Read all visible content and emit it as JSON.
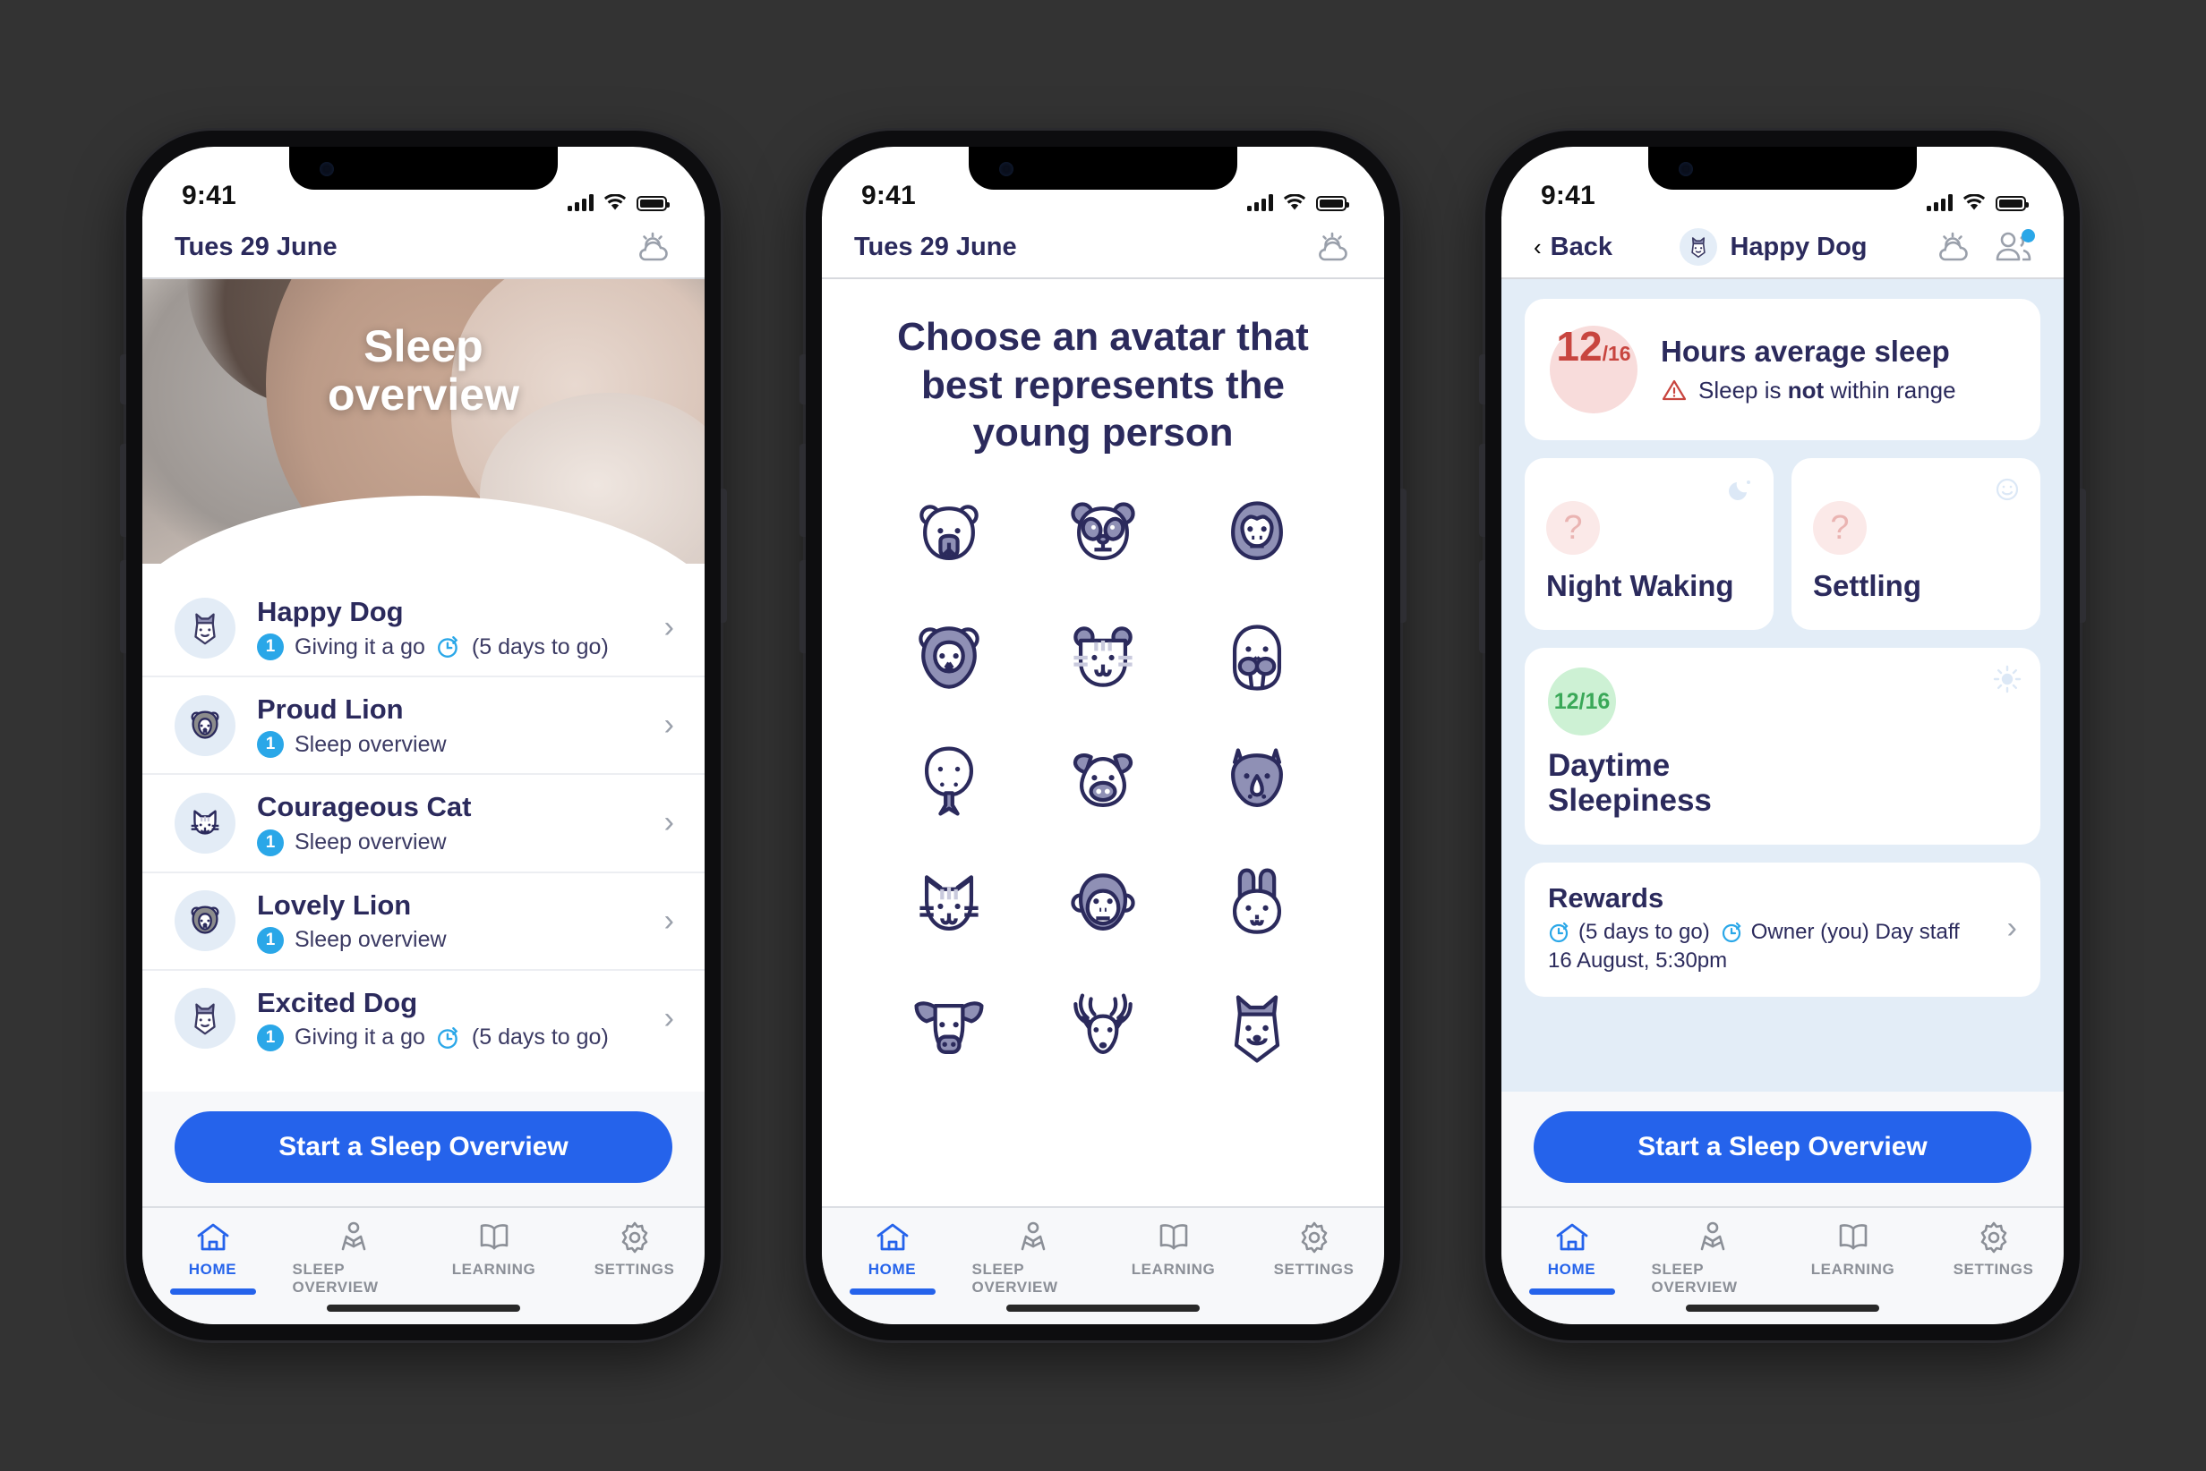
{
  "status_bar": {
    "time": "9:41",
    "signal_icon": "cellular-bars-icon",
    "wifi_icon": "wifi-icon",
    "battery_icon": "battery-icon"
  },
  "tabs": [
    {
      "label": "HOME",
      "icon": "home-icon",
      "active": true
    },
    {
      "label": "SLEEP OVERVIEW",
      "icon": "person-reading-icon",
      "active": false
    },
    {
      "label": "LEARNING",
      "icon": "book-icon",
      "active": false
    },
    {
      "label": "SETTINGS",
      "icon": "gear-icon",
      "active": false
    }
  ],
  "cta": {
    "label": "Start a Sleep Overview"
  },
  "colors": {
    "primary_blue": "#2563eb",
    "badge_blue": "#2aa7e8",
    "navy": "#2b2a5c",
    "alert_red": "#c8453f",
    "ok_green": "#3aa858",
    "tint_bg": "#e3edf7"
  },
  "screen1": {
    "appbar": {
      "date": "Tues 29 June",
      "weather_icon": "partly-cloudy-icon"
    },
    "hero": {
      "title_line1": "Sleep",
      "title_line2": "overview"
    },
    "children": [
      {
        "name": "Happy Dog",
        "avatar": "dog-icon",
        "badge": "1",
        "status": "Giving it a go",
        "timer_icon": "timer-icon",
        "timer_text": "(5 days to go)"
      },
      {
        "name": "Proud Lion",
        "avatar": "lion-icon",
        "badge": "1",
        "status": "Sleep overview",
        "timer_icon": "",
        "timer_text": ""
      },
      {
        "name": "Courageous Cat",
        "avatar": "cat-icon",
        "badge": "1",
        "status": "Sleep overview",
        "timer_icon": "",
        "timer_text": ""
      },
      {
        "name": "Lovely Lion",
        "avatar": "lion-icon",
        "badge": "1",
        "status": "Sleep overview",
        "timer_icon": "",
        "timer_text": ""
      },
      {
        "name": "Excited Dog",
        "avatar": "dog-icon",
        "badge": "1",
        "status": "Giving it a go",
        "timer_icon": "timer-icon",
        "timer_text": "(5 days to go)"
      }
    ]
  },
  "screen2": {
    "appbar": {
      "date": "Tues 29 June",
      "weather_icon": "partly-cloudy-icon"
    },
    "heading": "Choose an avatar that best represents the young person",
    "avatars": [
      "bear-icon",
      "panda-icon",
      "gorilla-icon",
      "lion-icon",
      "tiger-icon",
      "walrus-icon",
      "whale-icon",
      "pig-icon",
      "rhino-icon",
      "cat-icon",
      "monkey-icon",
      "rabbit-icon",
      "cow-icon",
      "deer-icon",
      "dog-icon"
    ]
  },
  "screen3": {
    "appbar": {
      "back_label": "Back",
      "title": "Happy Dog",
      "avatar_icon": "dog-icon",
      "weather_icon": "partly-cloudy-icon",
      "people_icon": "people-icon",
      "notification_dot": true
    },
    "hours_card": {
      "value": "12",
      "max": "/16",
      "title": "Hours average sleep",
      "warning_icon": "warning-triangle-icon",
      "note_prefix": "Sleep is ",
      "note_bold": "not",
      "note_suffix": " within range"
    },
    "metric_cards": [
      {
        "label": "Night Waking",
        "value": "?",
        "corner_icon": "moon-icon"
      },
      {
        "label": "Settling",
        "value": "?",
        "corner_icon": "smiley-icon"
      }
    ],
    "daytime_card": {
      "score": "12/16",
      "label_line1": "Daytime",
      "label_line2": "Sleepiness",
      "corner_icon": "sun-icon"
    },
    "rewards_card": {
      "title": "Rewards",
      "timer_icon": "timer-icon",
      "days_text": "(5 days to go)",
      "owner_icon": "timer-icon",
      "owner_text": "Owner (you) Day staff",
      "date_text": "16 August, 5:30pm",
      "chevron_icon": "chevron-right-icon"
    }
  }
}
